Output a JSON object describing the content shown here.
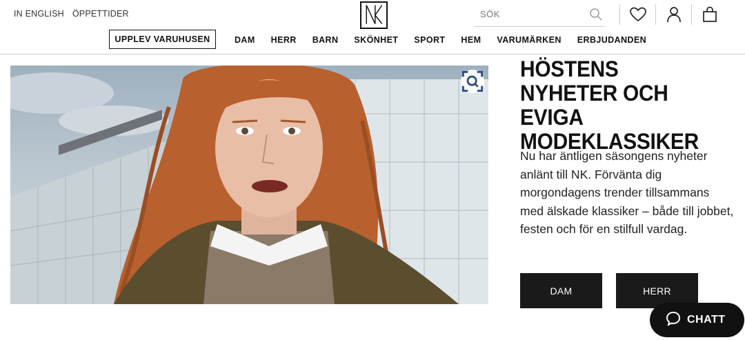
{
  "utility": {
    "english": "IN ENGLISH",
    "hours": "ÖPPETTIDER"
  },
  "logo": {
    "text": "NK"
  },
  "search": {
    "placeholder": "SÖK"
  },
  "icons": {
    "search": "search-icon",
    "wishlist": "heart-icon",
    "account": "user-icon",
    "cart": "shopping-bag-icon",
    "lens": "visual-search-icon",
    "chat": "chat-bubble-icon"
  },
  "nav": {
    "featured": "UPPLEV VARUHUSEN",
    "items": [
      "DAM",
      "HERR",
      "BARN",
      "SKÖNHET",
      "SPORT",
      "HEM",
      "VARUMÄRKEN",
      "ERBJUDANDEN"
    ]
  },
  "hero": {
    "title": "HÖSTENS NYHETER OCH EVIGA MODEKLASSIKER",
    "body": "Nu har äntligen säsongens nyheter anlänt till NK. Förvänta dig morgondagens trender tillsammans med älskade klassiker – både till jobbet, festen och för en stilfull vardag.",
    "cta_women": "DAM",
    "cta_men": "HERR"
  },
  "chat": {
    "label": "CHATT"
  },
  "colors": {
    "text": "#111111",
    "button": "#1a1a1a",
    "hair": "#b8602e"
  }
}
